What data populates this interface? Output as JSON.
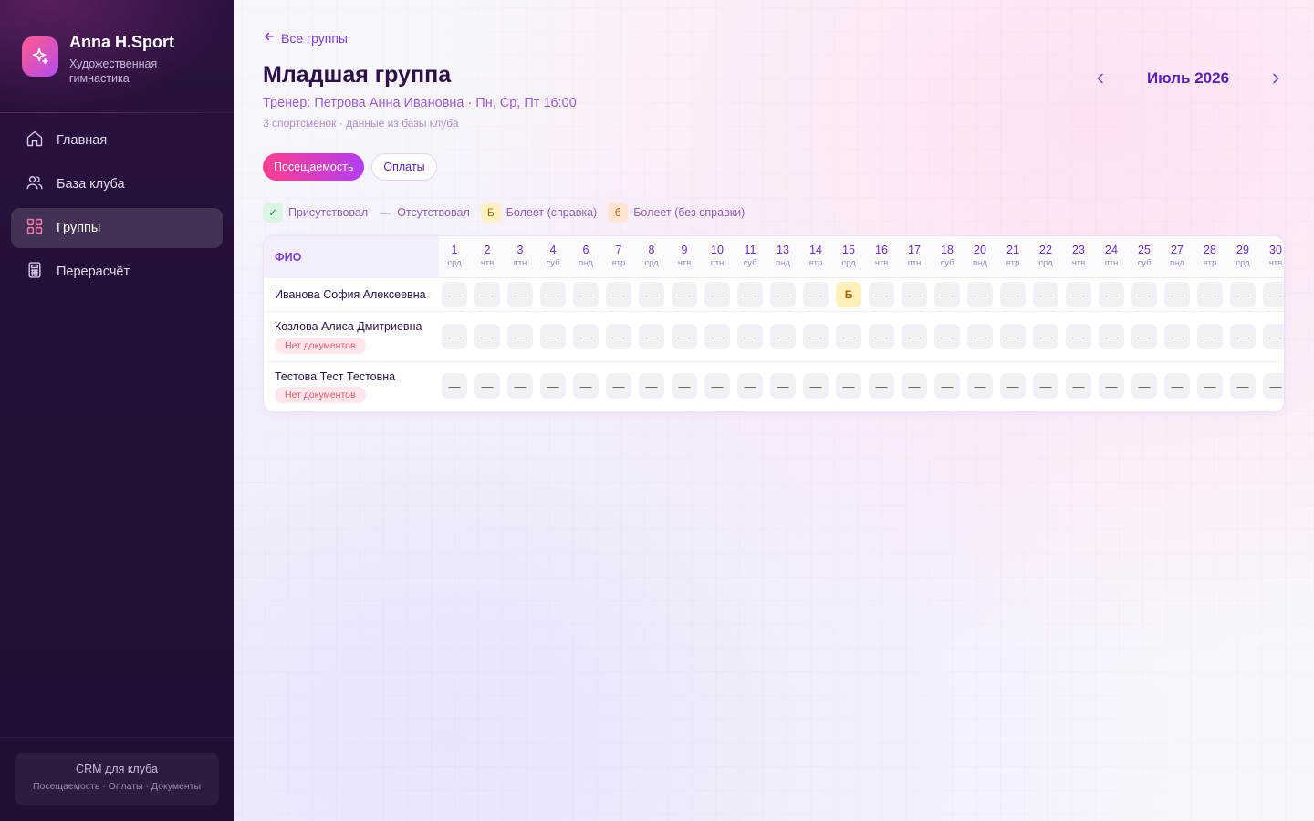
{
  "brand": {
    "name": "Anna H.Sport",
    "subtitle": "Художественная гимнастика"
  },
  "nav": {
    "items": [
      {
        "label": "Главная",
        "icon": "home-icon",
        "active": false
      },
      {
        "label": "База клуба",
        "icon": "users-icon",
        "active": false
      },
      {
        "label": "Группы",
        "icon": "grid-icon",
        "active": true
      },
      {
        "label": "Перерасчёт",
        "icon": "calculator-icon",
        "active": false
      }
    ]
  },
  "footer": {
    "title": "CRM для клуба",
    "subtitle": "Посещаемость · Оплаты · Документы"
  },
  "header": {
    "back_label": "Все группы",
    "title": "Младшая группа",
    "subtitle": "Тренер: Петрова Анна Ивановна · Пн, Ср, Пт 16:00",
    "meta": "3 спортсменок · данные из базы клуба",
    "month": "Июль 2026"
  },
  "tabs": [
    {
      "label": "Посещаемость",
      "active": true
    },
    {
      "label": "Оплаты",
      "active": false
    }
  ],
  "legend": [
    {
      "symbol": "✓",
      "label": "Присутствовал",
      "kind": "present"
    },
    {
      "symbol": "—",
      "label": "Отсутствовал",
      "kind": "absent"
    },
    {
      "symbol": "Б",
      "label": "Болеет (справка)",
      "kind": "sick"
    },
    {
      "symbol": "б",
      "label": "Болеет (без справки)",
      "kind": "sick-nodoc"
    }
  ],
  "table": {
    "name_header": "ФИО",
    "days": [
      {
        "num": "1",
        "wd": "срд"
      },
      {
        "num": "2",
        "wd": "чтв"
      },
      {
        "num": "3",
        "wd": "птн"
      },
      {
        "num": "4",
        "wd": "суб"
      },
      {
        "num": "6",
        "wd": "пнд"
      },
      {
        "num": "7",
        "wd": "втр"
      },
      {
        "num": "8",
        "wd": "срд"
      },
      {
        "num": "9",
        "wd": "чтв"
      },
      {
        "num": "10",
        "wd": "птн"
      },
      {
        "num": "11",
        "wd": "суб"
      },
      {
        "num": "13",
        "wd": "пнд"
      },
      {
        "num": "14",
        "wd": "втр"
      },
      {
        "num": "15",
        "wd": "срд"
      },
      {
        "num": "16",
        "wd": "чтв"
      },
      {
        "num": "17",
        "wd": "птн"
      },
      {
        "num": "18",
        "wd": "суб"
      },
      {
        "num": "20",
        "wd": "пнд"
      },
      {
        "num": "21",
        "wd": "втр"
      },
      {
        "num": "22",
        "wd": "срд"
      },
      {
        "num": "23",
        "wd": "чтв"
      },
      {
        "num": "24",
        "wd": "птн"
      },
      {
        "num": "25",
        "wd": "суб"
      },
      {
        "num": "27",
        "wd": "пнд"
      },
      {
        "num": "28",
        "wd": "втр"
      },
      {
        "num": "29",
        "wd": "срд"
      },
      {
        "num": "30",
        "wd": "чтв"
      }
    ],
    "rows": [
      {
        "name": "Иванова София Алексеевна",
        "badge": "",
        "marks": [
          "—",
          "—",
          "—",
          "—",
          "—",
          "—",
          "—",
          "—",
          "—",
          "—",
          "—",
          "—",
          "Б",
          "—",
          "—",
          "—",
          "—",
          "—",
          "—",
          "—",
          "—",
          "—",
          "—",
          "—",
          "—",
          "—"
        ]
      },
      {
        "name": "Козлова Алиса Дмитриевна",
        "badge": "Нет документов",
        "marks": [
          "—",
          "—",
          "—",
          "—",
          "—",
          "—",
          "—",
          "—",
          "—",
          "—",
          "—",
          "—",
          "—",
          "—",
          "—",
          "—",
          "—",
          "—",
          "—",
          "—",
          "—",
          "—",
          "—",
          "—",
          "—",
          "—"
        ]
      },
      {
        "name": "Тестова Тест Тестовна",
        "badge": "Нет документов",
        "marks": [
          "—",
          "—",
          "—",
          "—",
          "—",
          "—",
          "—",
          "—",
          "—",
          "—",
          "—",
          "—",
          "—",
          "—",
          "—",
          "—",
          "—",
          "—",
          "—",
          "—",
          "—",
          "—",
          "—",
          "—",
          "—",
          "—"
        ]
      }
    ]
  }
}
